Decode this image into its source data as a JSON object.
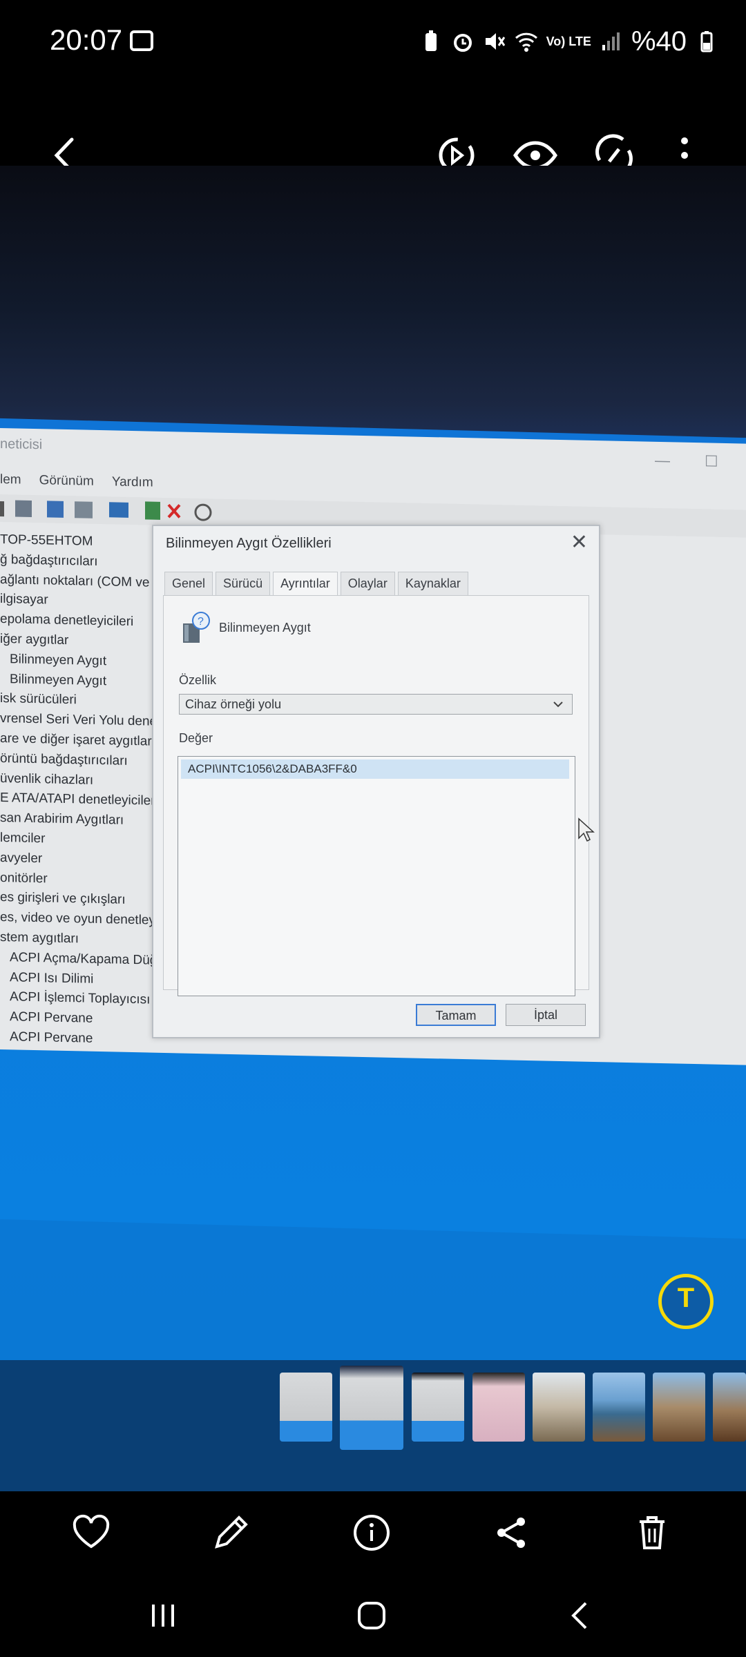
{
  "status_bar": {
    "time": "20:07",
    "volte_label": "Vo) LTE",
    "battery_text": "%40",
    "icons": [
      "gallery-icon",
      "battery-saver-icon",
      "alarm-icon",
      "mute-icon",
      "wifi-icon",
      "signal-icon",
      "battery-icon"
    ]
  },
  "top_toolbar": {
    "icons": [
      "back-icon",
      "motion-play-icon",
      "visibility-icon",
      "rotate-icon",
      "more-options-icon"
    ]
  },
  "photo": {
    "device_manager": {
      "title_fragment": "neticisi",
      "menu": [
        "lem",
        "Görünüm",
        "Yardım"
      ],
      "tree": [
        "TOP-55EHTOM",
        "ğ bağdaştırıcıları",
        "ağlantı noktaları (COM ve L",
        "ilgisayar",
        "epolama denetleyicileri",
        "iğer aygıtlar",
        "Bilinmeyen Aygıt",
        "Bilinmeyen Aygıt",
        "isk sürücüleri",
        "vrensel Seri Veri Yolu denetl",
        "are ve diğer işaret aygıtları",
        "örüntü bağdaştırıcıları",
        "üvenlik cihazları",
        "E ATA/ATAPI denetleyiciler",
        "san Arabirim Aygıtları",
        "lemciler",
        "avyeler",
        "onitörler",
        "es girişleri ve çıkışları",
        "es, video ve oyun denetleyic",
        "stem aygıtları",
        "ACPI Açma/Kapama Düğ",
        "ACPI Isı Dilimi",
        "ACPI İşlemci Toplayıcısı",
        "ACPI Pervane",
        "ACPI Pervane"
      ]
    },
    "dialog": {
      "title": "Bilinmeyen Aygıt Özellikleri",
      "close": "✕",
      "tabs": [
        "Genel",
        "Sürücü",
        "Ayrıntılar",
        "Olaylar",
        "Kaynaklar"
      ],
      "device_name": "Bilinmeyen Aygıt",
      "property_label": "Özellik",
      "property_value": "Cihaz örneği yolu",
      "value_label": "Değer",
      "value_row": "ACPI\\INTC1056\\2&DABA3FF&0",
      "ok_button": "Tamam",
      "cancel_button": "İptal"
    }
  },
  "text_recognition_button": "T",
  "filmstrip": {
    "thumbnails": [
      "screenshot-thumb",
      "screenshot-thumb-selected",
      "screenshot-thumb",
      "phone-thumb",
      "portrait-thumb",
      "coast-thumb",
      "coast-thumb",
      "coast-thumb"
    ]
  },
  "bottom_actions": {
    "icons": [
      "favorite-icon",
      "edit-icon",
      "info-icon",
      "share-icon",
      "delete-icon"
    ]
  },
  "nav_bar": {
    "icons": [
      "recent-apps-icon",
      "home-icon",
      "back-nav-icon"
    ]
  },
  "colors": {
    "accent_yellow": "#f5d90a",
    "screen_blue": "#0a78d4",
    "filmstrip_bg": "#0a3f74"
  }
}
